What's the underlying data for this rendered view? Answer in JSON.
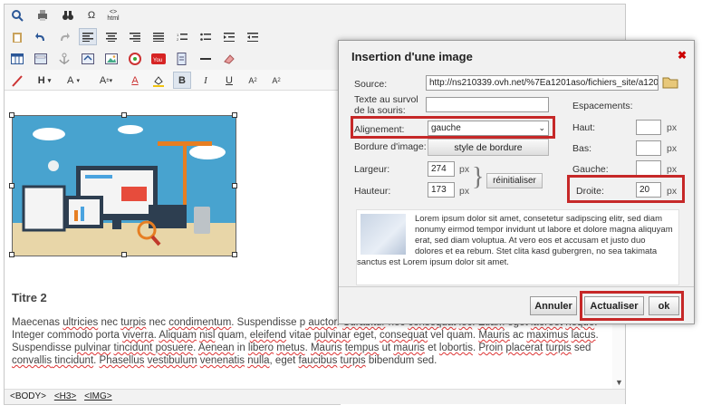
{
  "editor": {
    "heading": "Titre 2",
    "paragraph": [
      {
        "t": "Maecenas ",
        "s": false
      },
      {
        "t": "ultricies",
        "s": true
      },
      {
        "t": " nec ",
        "s": false
      },
      {
        "t": "turpis",
        "s": true
      },
      {
        "t": " nec ",
        "s": false
      },
      {
        "t": "condimentum",
        "s": true
      },
      {
        "t": ". Suspendisse p",
        "s": false
      },
      {
        "t": " auctor",
        "s": true
      },
      {
        "t": ". ",
        "s": false
      },
      {
        "t": "Curabitur",
        "s": true
      },
      {
        "t": " nec ",
        "s": false
      },
      {
        "t": "consequat",
        "s": true
      },
      {
        "t": " ",
        "s": false
      },
      {
        "t": "lec",
        "s": true
      },
      {
        "t": ". ",
        "s": false
      },
      {
        "t": "Etiam",
        "s": true
      },
      {
        "t": " eget ",
        "s": false
      },
      {
        "t": "laoreet",
        "s": true
      },
      {
        "t": " ",
        "s": false
      },
      {
        "t": "neque",
        "s": true
      },
      {
        "t": ". Integer commodo porta ",
        "s": false
      },
      {
        "t": "viverra",
        "s": true
      },
      {
        "t": ". ",
        "s": false
      },
      {
        "t": "Aliquam",
        "s": true
      },
      {
        "t": " ",
        "s": false
      },
      {
        "t": "nisl",
        "s": true
      },
      {
        "t": " quam, ",
        "s": false
      },
      {
        "t": "eleifend",
        "s": true
      },
      {
        "t": " vitae ",
        "s": false
      },
      {
        "t": "pulvinar",
        "s": true
      },
      {
        "t": " eget, ",
        "s": false
      },
      {
        "t": "consequat",
        "s": true
      },
      {
        "t": " vel quam. ",
        "s": false
      },
      {
        "t": "Mauris",
        "s": true
      },
      {
        "t": " ac ",
        "s": false
      },
      {
        "t": "maximus",
        "s": true
      },
      {
        "t": " ",
        "s": false
      },
      {
        "t": "lacus",
        "s": true
      },
      {
        "t": ". Suspendisse ",
        "s": false
      },
      {
        "t": "pulvinar",
        "s": true
      },
      {
        "t": " ",
        "s": false
      },
      {
        "t": "tincidunt",
        "s": true
      },
      {
        "t": " posuere",
        "s": true
      },
      {
        "t": ". ",
        "s": false
      },
      {
        "t": "Aenean",
        "s": true
      },
      {
        "t": " in ",
        "s": false
      },
      {
        "t": "libero",
        "s": true
      },
      {
        "t": " ",
        "s": false
      },
      {
        "t": "metus",
        "s": true
      },
      {
        "t": ". ",
        "s": false
      },
      {
        "t": "Mauris",
        "s": true
      },
      {
        "t": " ",
        "s": false
      },
      {
        "t": "tempus",
        "s": true
      },
      {
        "t": " ut ",
        "s": false
      },
      {
        "t": "mauris",
        "s": true
      },
      {
        "t": " et ",
        "s": false
      },
      {
        "t": "lobortis",
        "s": true
      },
      {
        "t": ". ",
        "s": false
      },
      {
        "t": "Proin",
        "s": true
      },
      {
        "t": " ",
        "s": false
      },
      {
        "t": "placerat",
        "s": true
      },
      {
        "t": " ",
        "s": false
      },
      {
        "t": "turpis",
        "s": true
      },
      {
        "t": " sed ",
        "s": false
      },
      {
        "t": "convallis",
        "s": true
      },
      {
        "t": " tincidunt",
        "s": true
      },
      {
        "t": ". ",
        "s": false
      },
      {
        "t": "Phasellus",
        "s": true
      },
      {
        "t": " ",
        "s": false
      },
      {
        "t": "vestibulum",
        "s": true
      },
      {
        "t": " ",
        "s": false
      },
      {
        "t": "venenatis",
        "s": true
      },
      {
        "t": " ",
        "s": false
      },
      {
        "t": "nulla",
        "s": true
      },
      {
        "t": ", eget ",
        "s": false
      },
      {
        "t": "faucibus",
        "s": true
      },
      {
        "t": " ",
        "s": false
      },
      {
        "t": "turpis",
        "s": true
      },
      {
        "t": " bibendum sed.",
        "s": false
      }
    ],
    "status_tags": [
      "<BODY>",
      "<H3>",
      "<IMG>"
    ],
    "toolbar_text": {
      "heading": "H",
      "font": "A",
      "size": "A",
      "color": "A",
      "bold": "B",
      "italic": "I",
      "underline": "U",
      "html": "html",
      "omega": "Ω",
      "source": "<>"
    }
  },
  "dialog": {
    "title": "Insertion d'une image",
    "source_label": "Source:",
    "source_value": "http://ns210339.ovh.net/%7Ea1201aso/fichiers_site/a120",
    "hover_label": "Texte au survol de la souris:",
    "hover_value": "",
    "align_label": "Alignement:",
    "align_value": "gauche",
    "border_label": "Bordure d'image:",
    "border_button": "style de bordure",
    "width_label": "Largeur:",
    "width_value": "274",
    "height_label": "Hauteur:",
    "height_value": "173",
    "px": "px",
    "reset_button": "réinitialiser",
    "spacing_label": "Espacements:",
    "top_label": "Haut:",
    "bottom_label": "Bas:",
    "left_label": "Gauche:",
    "right_label": "Droite:",
    "right_value": "20",
    "preview_text": "Lorem ipsum dolor sit amet, consetetur sadipscing elitr, sed diam nonumy eirmod tempor invidunt ut labore et dolore magna aliquyam erat, sed diam voluptua. At vero eos et accusam et justo duo dolores et ea rebum. Stet clita kasd gubergren, no sea takimata sanctus est Lorem ipsum dolor sit amet.",
    "cancel": "Annuler",
    "update": "Actualiser",
    "ok": "ok"
  },
  "colors": {
    "highlight": "#c62828",
    "close": "#cc0000"
  }
}
